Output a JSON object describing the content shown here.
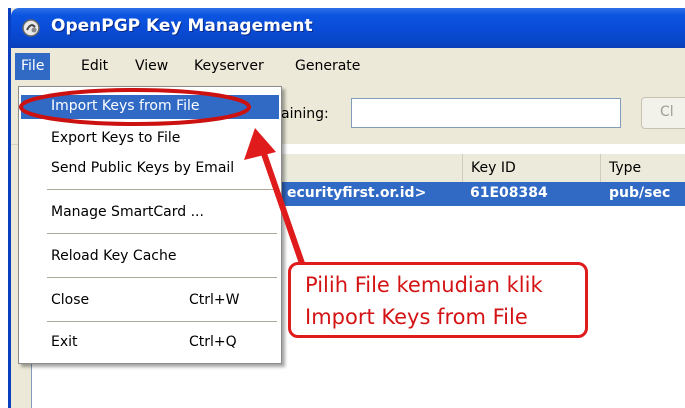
{
  "window": {
    "title": "OpenPGP Key Management"
  },
  "menubar": {
    "items": [
      {
        "label": "File"
      },
      {
        "label": "Edit"
      },
      {
        "label": "View"
      },
      {
        "label": "Keyserver"
      },
      {
        "label": "Generate"
      }
    ]
  },
  "toolbar": {
    "search_label": "aining:",
    "search_value": "",
    "clear_label": "Cl"
  },
  "key_list": {
    "columns": [
      "Key ID",
      "Type"
    ],
    "rows": [
      {
        "user_id": "ecurityfirst.or.id>",
        "key_id": "61E08384",
        "type": "pub/sec"
      }
    ]
  },
  "file_menu": {
    "items": [
      {
        "label": "Import Keys from File",
        "shortcut": ""
      },
      {
        "label": "Export Keys to File",
        "shortcut": ""
      },
      {
        "label": "Send Public Keys by Email",
        "shortcut": ""
      },
      {
        "label": "Manage SmartCard ...",
        "shortcut": ""
      },
      {
        "label": "Reload Key Cache",
        "shortcut": ""
      },
      {
        "label": "Close",
        "shortcut": "Ctrl+W"
      },
      {
        "label": "Exit",
        "shortcut": "Ctrl+Q"
      }
    ]
  },
  "annotation": {
    "line1": "Pilih File kemudian klik",
    "line2": "Import Keys from File"
  },
  "colors": {
    "title_bar": "#0a4bd6",
    "selection": "#316ac5",
    "annotation_red": "#e01b1b"
  }
}
